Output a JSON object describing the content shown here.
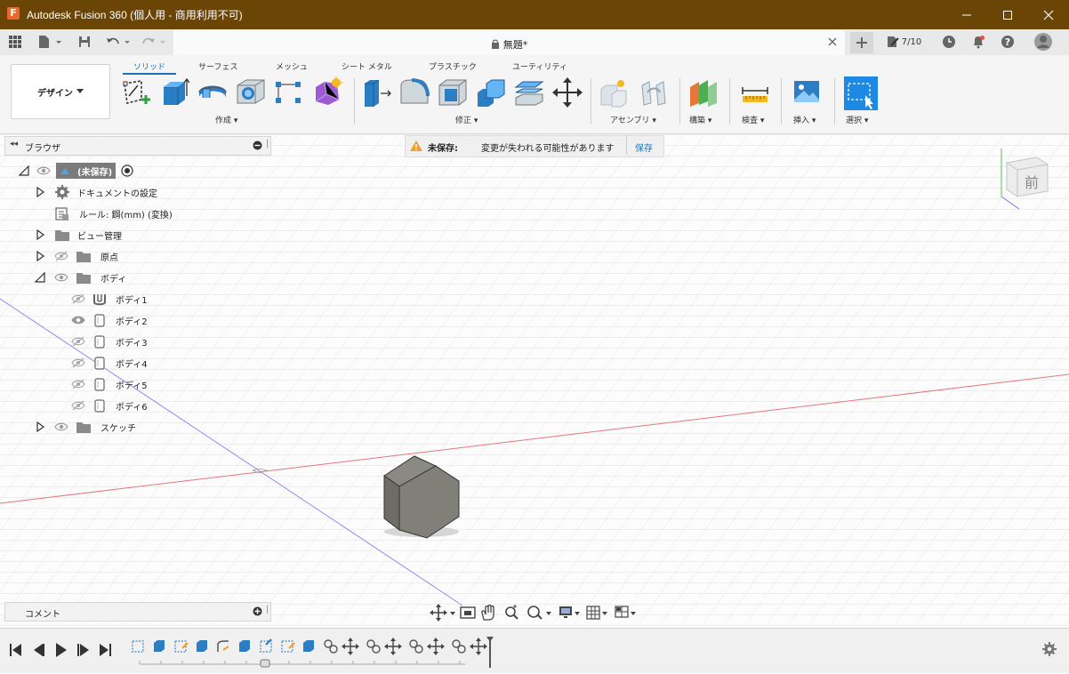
{
  "window": {
    "title": "Autodesk Fusion 360 (個人用 - 商用利用不可)",
    "app_icon": "F",
    "controls": [
      "minimize-icon",
      "maximize-icon",
      "close-icon"
    ]
  },
  "tabbar": {
    "doc_title": "無題*",
    "job_count": "7/10"
  },
  "toolbar": {
    "workspace": "デザイン",
    "tabs": [
      "ソリッド",
      "サーフェス",
      "メッシュ",
      "シート メタル",
      "プラスチック",
      "ユーティリティ"
    ],
    "active_tab": "ソリッド",
    "groups": {
      "create": "作成",
      "modify": "修正",
      "assemble": "アセンブリ",
      "construct": "構築",
      "inspect": "検査",
      "insert": "挿入",
      "select": "選択"
    }
  },
  "browser": {
    "title": "ブラウザ",
    "root": "(未保存)",
    "items": {
      "doc_settings": "ドキュメントの設定",
      "units": "ルール: 鋼(mm) (変換)",
      "named_views": "ビュー管理",
      "origin": "原点",
      "bodies": "ボディ",
      "body1": "ボディ1",
      "body2": "ボディ2",
      "body3": "ボディ3",
      "body4": "ボディ4",
      "body5": "ボディ5",
      "body6": "ボディ6",
      "sketches": "スケッチ"
    }
  },
  "warning": {
    "label": "未保存:",
    "message": "変更が失われる可能性があります",
    "action": "保存"
  },
  "viewcube": {
    "face": "前"
  },
  "comments": {
    "title": "コメント"
  },
  "colors": {
    "titlebar": "#6b4506",
    "accent": "#1e6fb6",
    "select_blue": "#1e88e5",
    "axis_red": "#e07a7a",
    "axis_blue": "#8c8cf0"
  }
}
